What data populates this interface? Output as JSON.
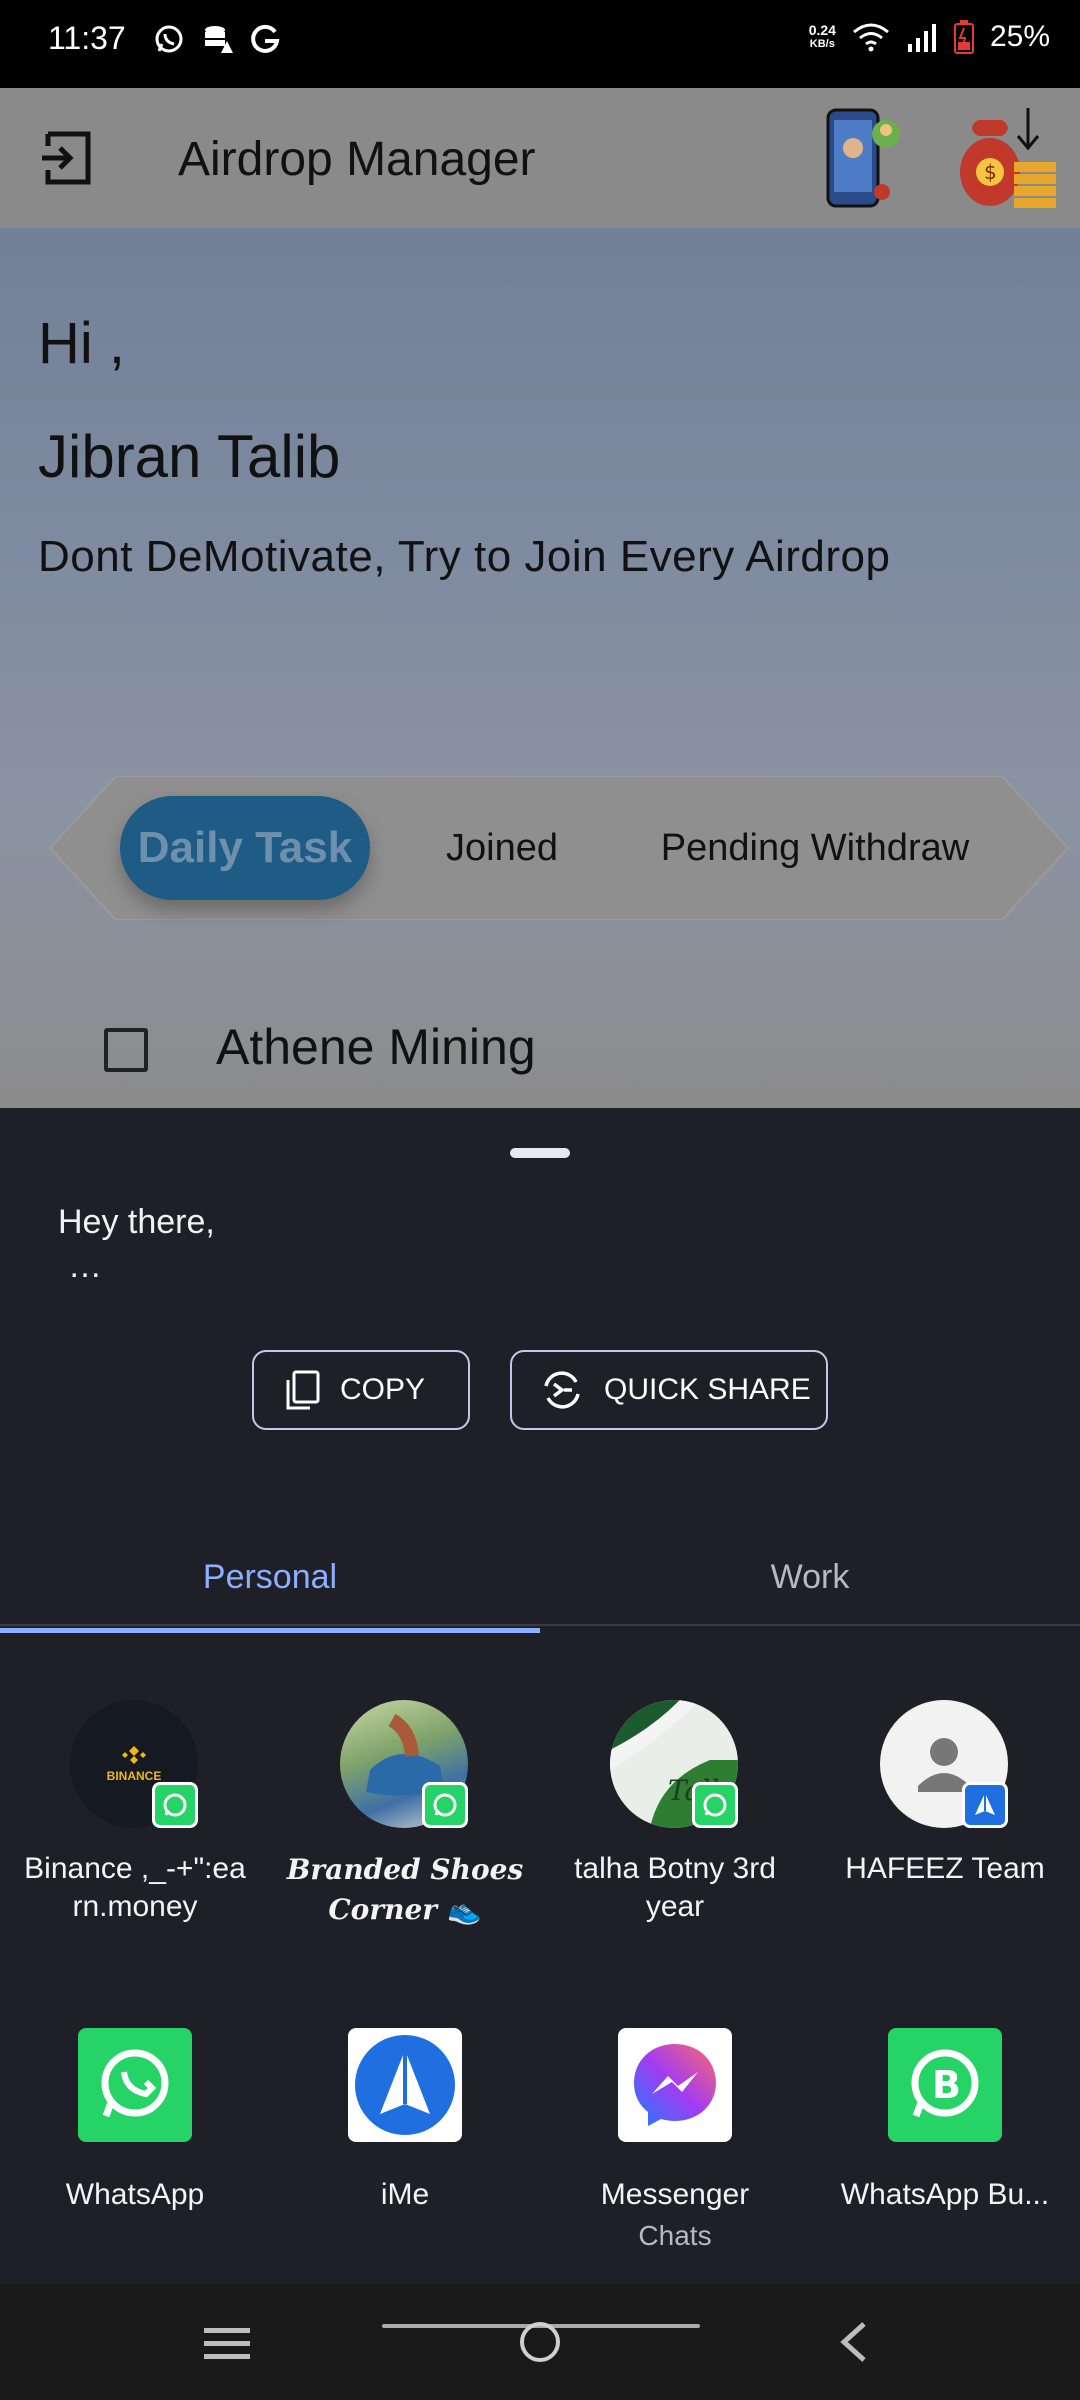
{
  "status_bar": {
    "time": "11:37",
    "net_speed_value": "0.24",
    "net_speed_unit": "KB/s",
    "battery": "25%",
    "left_icons": [
      "whatsapp-icon",
      "database-icon",
      "google-icon"
    ]
  },
  "app": {
    "title": "Airdrop Manager",
    "greeting": "Hi ,",
    "user_name": "Jibran Talib",
    "motto": "Dont DeMotivate, Try to Join Every Airdrop",
    "tabs": [
      {
        "label": "Daily Task",
        "active": true
      },
      {
        "label": "Joined",
        "active": false
      },
      {
        "label": "Pending Withdraw",
        "active": false
      }
    ],
    "task": {
      "label": "Athene Mining",
      "checked": false
    }
  },
  "share_sheet": {
    "text_line1": "Hey there,",
    "text_line2": "…",
    "copy_label": "COPY",
    "quick_share_label": "QUICK SHARE",
    "tabs": [
      {
        "label": "Personal",
        "active": true
      },
      {
        "label": "Work",
        "active": false
      }
    ],
    "direct_targets": [
      {
        "label": "Binance ,_-+\":earn.money",
        "label_line1": "Binance ,_-+\":ea",
        "label_line2": "rn.money",
        "avatar_text": "BINANCE",
        "badge": "whatsapp"
      },
      {
        "label": "Branded Shoes Corner 👟",
        "label_line1": "Branded Shoes",
        "label_line2": "Corner 👟",
        "badge": "whatsapp"
      },
      {
        "label": "talha Botny 3rd year",
        "label_line1": "talha Botny 3rd",
        "label_line2": "year",
        "badge": "whatsapp"
      },
      {
        "label": "HAFEEZ Team",
        "label_line1": "HAFEEZ Team",
        "label_line2": "",
        "badge": "ime"
      }
    ],
    "apps": [
      {
        "label": "WhatsApp",
        "sub": "",
        "color": "#25d366"
      },
      {
        "label": "iMe",
        "sub": "",
        "color": "#1f6fe0"
      },
      {
        "label": "Messenger",
        "sub": "Chats",
        "color": "#a23cf2"
      },
      {
        "label": "WhatsApp Bu...",
        "sub": "",
        "color": "#25d366"
      }
    ]
  },
  "colors": {
    "sheet_bg": "#1f1f27",
    "accent": "#8ab0ff",
    "active_tab_bg": "#1e5c86"
  }
}
